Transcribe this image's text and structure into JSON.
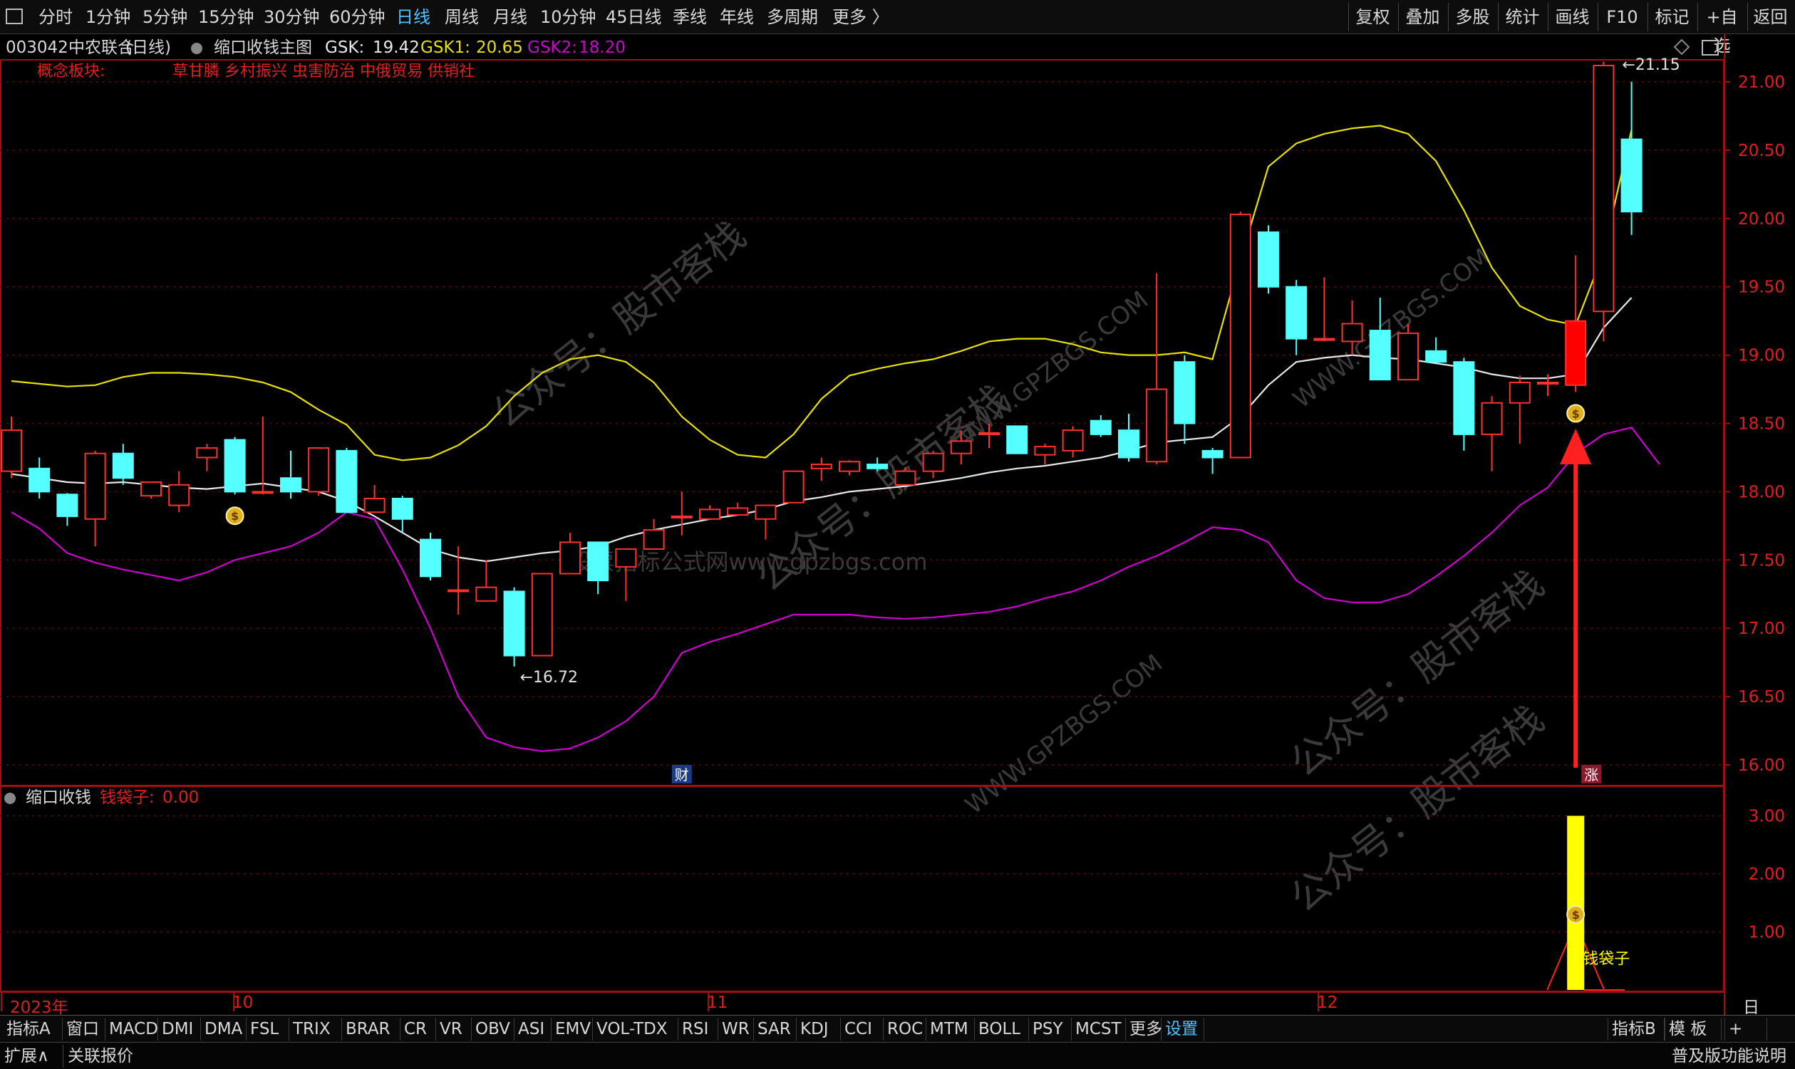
{
  "topbar": {
    "periods": [
      "分时",
      "1分钟",
      "5分钟",
      "15分钟",
      "30分钟",
      "60分钟",
      "日线",
      "周线",
      "月线",
      "10分钟",
      "45日线",
      "季线",
      "年线",
      "多周期",
      "更多 〉"
    ],
    "active_period": "日线",
    "right_buttons": [
      "复权",
      "叠加",
      "多股",
      "统计",
      "画线",
      "F10",
      "标记",
      "+自选",
      "返回"
    ]
  },
  "stock": {
    "code": "003042",
    "name": "中农联合",
    "period_label": "(日线)",
    "indicator_name": "缩口收钱主图",
    "gsk_label": "GSK:",
    "gsk_value": "19.42",
    "gsk1_label": "GSK1:",
    "gsk1_value": "20.65",
    "gsk2_label": "GSK2:",
    "gsk2_value": "18.20"
  },
  "concept": {
    "label": "概念板块:",
    "values": "草甘膦 乡村振兴 虫害防治 中俄贸易 供销社"
  },
  "main_axis": {
    "labels": [
      "21.00",
      "20.50",
      "20.00",
      "19.50",
      "19.00",
      "18.50",
      "18.00",
      "17.50",
      "17.00",
      "16.50",
      "16.00"
    ]
  },
  "annotations": {
    "high_label": "21.15",
    "low_label": "16.72",
    "marker_cai": "财",
    "marker_zhang": "涨"
  },
  "sub_panel": {
    "name": "缩口收钱",
    "series_label": "钱袋子:",
    "series_value": "0.00",
    "axis_labels": [
      "3.00",
      "2.00",
      "1.00"
    ],
    "bar_label": "钱袋子"
  },
  "time_axis": {
    "labels": [
      "2023年",
      "10",
      "11",
      "12"
    ],
    "period": "日线"
  },
  "indicator_tabs": [
    "指标A",
    "窗口",
    "MACD",
    "DMI",
    "DMA",
    "FSL",
    "TRIX",
    "BRAR",
    "CR",
    "VR",
    "OBV",
    "ASI",
    "EMV",
    "VOL-TDX",
    "RSI",
    "WR",
    "SAR",
    "KDJ",
    "CCI",
    "ROC",
    "MTM",
    "BOLL",
    "PSY",
    "MCST",
    "更多",
    "设置"
  ],
  "indicator_right": [
    "指标B",
    "模 板",
    "+"
  ],
  "statusbar": {
    "expand": "扩展∧",
    "related": "关联报价",
    "right": "普及版功能说明"
  },
  "watermarks": [
    "公众号：股市客栈",
    "股票指标公式网www.gpzbgs.com",
    "WWW.GPZBGS.COM"
  ],
  "colors": {
    "up": "#ff3030",
    "down": "#54ffff",
    "upper_band": "#e8e000",
    "lower_band": "#d000d0",
    "mid_line": "#e8e8e8",
    "signal_bar": "#ffff00",
    "arrow": "#ff2020",
    "frame": "#a01010"
  },
  "chart_data": {
    "type": "candlestick",
    "ylim": [
      15.9,
      21.2
    ],
    "candles": [
      {
        "o": 18.15,
        "h": 18.55,
        "l": 18.1,
        "c": 18.45
      },
      {
        "o": 18.17,
        "h": 18.25,
        "l": 17.95,
        "c": 18.0
      },
      {
        "o": 17.98,
        "h": 17.99,
        "l": 17.75,
        "c": 17.82
      },
      {
        "o": 17.8,
        "h": 18.3,
        "l": 17.6,
        "c": 18.28
      },
      {
        "o": 18.28,
        "h": 18.35,
        "l": 18.05,
        "c": 18.1
      },
      {
        "o": 17.97,
        "h": 18.07,
        "l": 17.95,
        "c": 18.07
      },
      {
        "o": 17.9,
        "h": 18.15,
        "l": 17.85,
        "c": 18.05
      },
      {
        "o": 18.25,
        "h": 18.35,
        "l": 18.15,
        "c": 18.32
      },
      {
        "o": 18.38,
        "h": 18.4,
        "l": 17.98,
        "c": 18.0
      },
      {
        "o": 18.0,
        "h": 18.55,
        "l": 17.98,
        "c": 18.0
      },
      {
        "o": 18.1,
        "h": 18.3,
        "l": 17.95,
        "c": 18.0
      },
      {
        "o": 18.0,
        "h": 18.32,
        "l": 17.97,
        "c": 18.32
      },
      {
        "o": 18.3,
        "h": 18.32,
        "l": 17.85,
        "c": 17.85
      },
      {
        "o": 17.85,
        "h": 18.05,
        "l": 17.85,
        "c": 17.95
      },
      {
        "o": 17.95,
        "h": 17.97,
        "l": 17.7,
        "c": 17.8
      },
      {
        "o": 17.65,
        "h": 17.7,
        "l": 17.35,
        "c": 17.38
      },
      {
        "o": 17.28,
        "h": 17.6,
        "l": 17.1,
        "c": 17.28
      },
      {
        "o": 17.2,
        "h": 17.5,
        "l": 17.2,
        "c": 17.3
      },
      {
        "o": 17.27,
        "h": 17.3,
        "l": 16.72,
        "c": 16.8
      },
      {
        "o": 16.8,
        "h": 17.4,
        "l": 16.8,
        "c": 17.4
      },
      {
        "o": 17.4,
        "h": 17.7,
        "l": 17.4,
        "c": 17.63
      },
      {
        "o": 17.63,
        "h": 17.63,
        "l": 17.25,
        "c": 17.35
      },
      {
        "o": 17.45,
        "h": 17.58,
        "l": 17.2,
        "c": 17.58
      },
      {
        "o": 17.58,
        "h": 17.8,
        "l": 17.58,
        "c": 17.72
      },
      {
        "o": 17.82,
        "h": 18.0,
        "l": 17.68,
        "c": 17.82
      },
      {
        "o": 17.8,
        "h": 17.9,
        "l": 17.8,
        "c": 17.87
      },
      {
        "o": 17.83,
        "h": 17.92,
        "l": 17.83,
        "c": 17.88
      },
      {
        "o": 17.8,
        "h": 17.9,
        "l": 17.65,
        "c": 17.9
      },
      {
        "o": 17.92,
        "h": 18.15,
        "l": 17.92,
        "c": 18.15
      },
      {
        "o": 18.17,
        "h": 18.25,
        "l": 18.08,
        "c": 18.2
      },
      {
        "o": 18.15,
        "h": 18.23,
        "l": 18.12,
        "c": 18.22
      },
      {
        "o": 18.2,
        "h": 18.25,
        "l": 18.15,
        "c": 18.17
      },
      {
        "o": 18.05,
        "h": 18.18,
        "l": 18.05,
        "c": 18.15
      },
      {
        "o": 18.15,
        "h": 18.3,
        "l": 18.1,
        "c": 18.28
      },
      {
        "o": 18.28,
        "h": 18.45,
        "l": 18.2,
        "c": 18.37
      },
      {
        "o": 18.43,
        "h": 18.5,
        "l": 18.32,
        "c": 18.43
      },
      {
        "o": 18.48,
        "h": 18.48,
        "l": 18.28,
        "c": 18.28
      },
      {
        "o": 18.27,
        "h": 18.35,
        "l": 18.2,
        "c": 18.33
      },
      {
        "o": 18.3,
        "h": 18.48,
        "l": 18.25,
        "c": 18.45
      },
      {
        "o": 18.52,
        "h": 18.56,
        "l": 18.4,
        "c": 18.42
      },
      {
        "o": 18.45,
        "h": 18.57,
        "l": 18.22,
        "c": 18.25
      },
      {
        "o": 18.22,
        "h": 19.6,
        "l": 18.2,
        "c": 18.75
      },
      {
        "o": 18.95,
        "h": 19.0,
        "l": 18.35,
        "c": 18.5
      },
      {
        "o": 18.3,
        "h": 18.32,
        "l": 18.13,
        "c": 18.25
      },
      {
        "o": 18.25,
        "h": 20.05,
        "l": 18.25,
        "c": 20.03
      },
      {
        "o": 19.9,
        "h": 19.95,
        "l": 19.45,
        "c": 19.5
      },
      {
        "o": 19.5,
        "h": 19.55,
        "l": 19.0,
        "c": 19.12
      },
      {
        "o": 19.12,
        "h": 19.57,
        "l": 19.1,
        "c": 19.12
      },
      {
        "o": 19.1,
        "h": 19.4,
        "l": 19.0,
        "c": 19.23
      },
      {
        "o": 19.18,
        "h": 19.42,
        "l": 18.82,
        "c": 18.82
      },
      {
        "o": 18.82,
        "h": 19.23,
        "l": 18.82,
        "c": 19.16
      },
      {
        "o": 19.03,
        "h": 19.13,
        "l": 18.95,
        "c": 18.95
      },
      {
        "o": 18.95,
        "h": 18.98,
        "l": 18.3,
        "c": 18.42
      },
      {
        "o": 18.42,
        "h": 18.7,
        "l": 18.15,
        "c": 18.65
      },
      {
        "o": 18.65,
        "h": 18.85,
        "l": 18.35,
        "c": 18.8
      },
      {
        "o": 18.8,
        "h": 18.86,
        "l": 18.7,
        "c": 18.8
      },
      {
        "o": 18.78,
        "h": 19.73,
        "l": 18.73,
        "c": 19.25
      },
      {
        "o": 19.32,
        "h": 21.15,
        "l": 19.1,
        "c": 21.12
      },
      {
        "o": 20.58,
        "h": 21.0,
        "l": 19.88,
        "c": 20.05
      }
    ],
    "up_body_override": [
      8,
      56
    ],
    "series": [
      {
        "name": "GSK",
        "values": [
          18.13,
          18.1,
          18.07,
          18.06,
          18.07,
          18.05,
          18.03,
          18.02,
          18.04,
          18.06,
          18.03,
          18.0,
          17.93,
          17.82,
          17.7,
          17.58,
          17.52,
          17.49,
          17.52,
          17.55,
          17.57,
          17.6,
          17.67,
          17.72,
          17.76,
          17.8,
          17.83,
          17.87,
          17.93,
          17.96,
          18.0,
          18.02,
          18.04,
          18.07,
          18.1,
          18.14,
          18.17,
          18.19,
          18.22,
          18.25,
          18.3,
          18.36,
          18.38,
          18.4,
          18.55,
          18.78,
          18.95,
          18.98,
          19.0,
          18.98,
          18.97,
          18.94,
          18.91,
          18.86,
          18.83,
          18.83,
          18.86,
          19.2,
          19.42
        ]
      },
      {
        "name": "GSK1",
        "values": [
          18.81,
          18.79,
          18.77,
          18.78,
          18.84,
          18.87,
          18.87,
          18.86,
          18.84,
          18.8,
          18.73,
          18.6,
          18.49,
          18.27,
          18.23,
          18.25,
          18.34,
          18.48,
          18.7,
          18.87,
          18.97,
          19.0,
          18.95,
          18.8,
          18.55,
          18.38,
          18.27,
          18.25,
          18.42,
          18.68,
          18.85,
          18.9,
          18.94,
          18.97,
          19.03,
          19.1,
          19.12,
          19.12,
          19.08,
          19.02,
          19.0,
          19.0,
          19.02,
          18.97,
          19.7,
          20.38,
          20.55,
          20.62,
          20.66,
          20.68,
          20.62,
          20.42,
          20.06,
          19.64,
          19.36,
          19.26,
          19.22,
          19.75,
          20.65
        ]
      },
      {
        "name": "GSK2",
        "values": [
          17.85,
          17.73,
          17.55,
          17.48,
          17.43,
          17.39,
          17.35,
          17.41,
          17.5,
          17.55,
          17.6,
          17.7,
          17.85,
          17.8,
          17.43,
          17.0,
          16.5,
          16.2,
          16.13,
          16.1,
          16.12,
          16.2,
          16.32,
          16.5,
          16.82,
          16.9,
          16.96,
          17.03,
          17.1,
          17.1,
          17.1,
          17.08,
          17.07,
          17.08,
          17.1,
          17.12,
          17.16,
          17.22,
          17.27,
          17.35,
          17.45,
          17.53,
          17.63,
          17.74,
          17.72,
          17.63,
          17.35,
          17.22,
          17.19,
          17.19,
          17.25,
          17.38,
          17.53,
          17.7,
          17.9,
          18.03,
          18.28,
          18.42,
          18.47,
          18.2
        ]
      }
    ],
    "signal": {
      "candle_index": 56,
      "value": 3.0
    }
  }
}
